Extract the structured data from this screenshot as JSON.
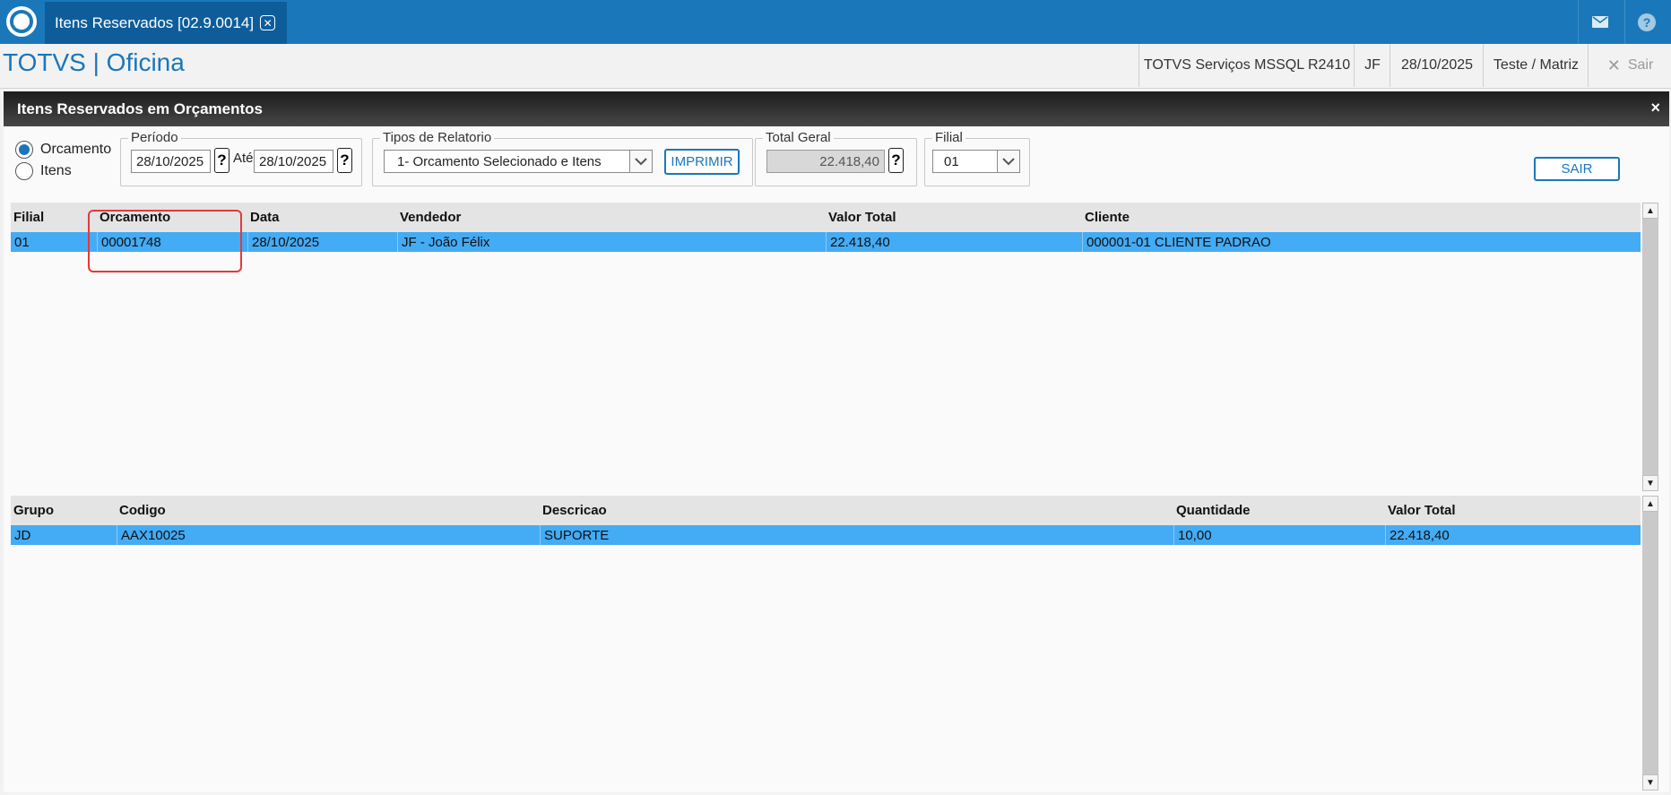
{
  "topbar": {
    "tab_label": "Itens Reservados [02.9.0014]",
    "tab_close_icon": "close-icon",
    "mail_icon": "envelope-icon",
    "help_icon": "question-icon"
  },
  "header": {
    "app_title": "TOTVS | Oficina",
    "environment": "TOTVS Serviços MSSQL R2410",
    "user": "JF",
    "date": "28/10/2025",
    "company": "Teste / Matriz",
    "exit_label": "Sair"
  },
  "window": {
    "title": "Itens Reservados em Orçamentos",
    "close_glyph": "×"
  },
  "filters": {
    "radio_options": [
      {
        "label": "Orcamento",
        "selected": true
      },
      {
        "label": "Itens",
        "selected": false
      }
    ],
    "periodo": {
      "label": "Período",
      "from": "28/10/2025",
      "ate_label": "Até",
      "to": "28/10/2025",
      "help_glyph": "?"
    },
    "tipos_relatorio": {
      "label": "Tipos de Relatorio",
      "selected": "1- Orcamento Selecionado e Itens",
      "print_label": "IMPRIMIR"
    },
    "total_geral": {
      "label": "Total Geral",
      "value": "22.418,40",
      "help_glyph": "?"
    },
    "filial": {
      "label": "Filial",
      "selected": "01"
    },
    "sair_label": "SAIR"
  },
  "orcamentos_grid": {
    "columns": [
      "Filial",
      "Orcamento",
      "Data",
      "Vendedor",
      "Valor Total",
      "Cliente"
    ],
    "rows": [
      [
        "01",
        "00001748",
        "28/10/2025",
        "JF - João Félix",
        "22.418,40",
        "000001-01 CLIENTE PADRAO"
      ]
    ]
  },
  "itens_grid": {
    "columns": [
      "Grupo",
      "Codigo",
      "Descricao",
      "Quantidade",
      "Valor Total"
    ],
    "rows": [
      [
        "JD",
        "AAX10025",
        "SUPORTE",
        "10,00",
        "22.418,40"
      ]
    ]
  },
  "colors": {
    "topbar": "#1a78ba",
    "tab_active": "#0e5d9a",
    "brand_text": "#1a76bb",
    "selected_row": "#44abf5",
    "highlight_box": "#e23a3a"
  }
}
